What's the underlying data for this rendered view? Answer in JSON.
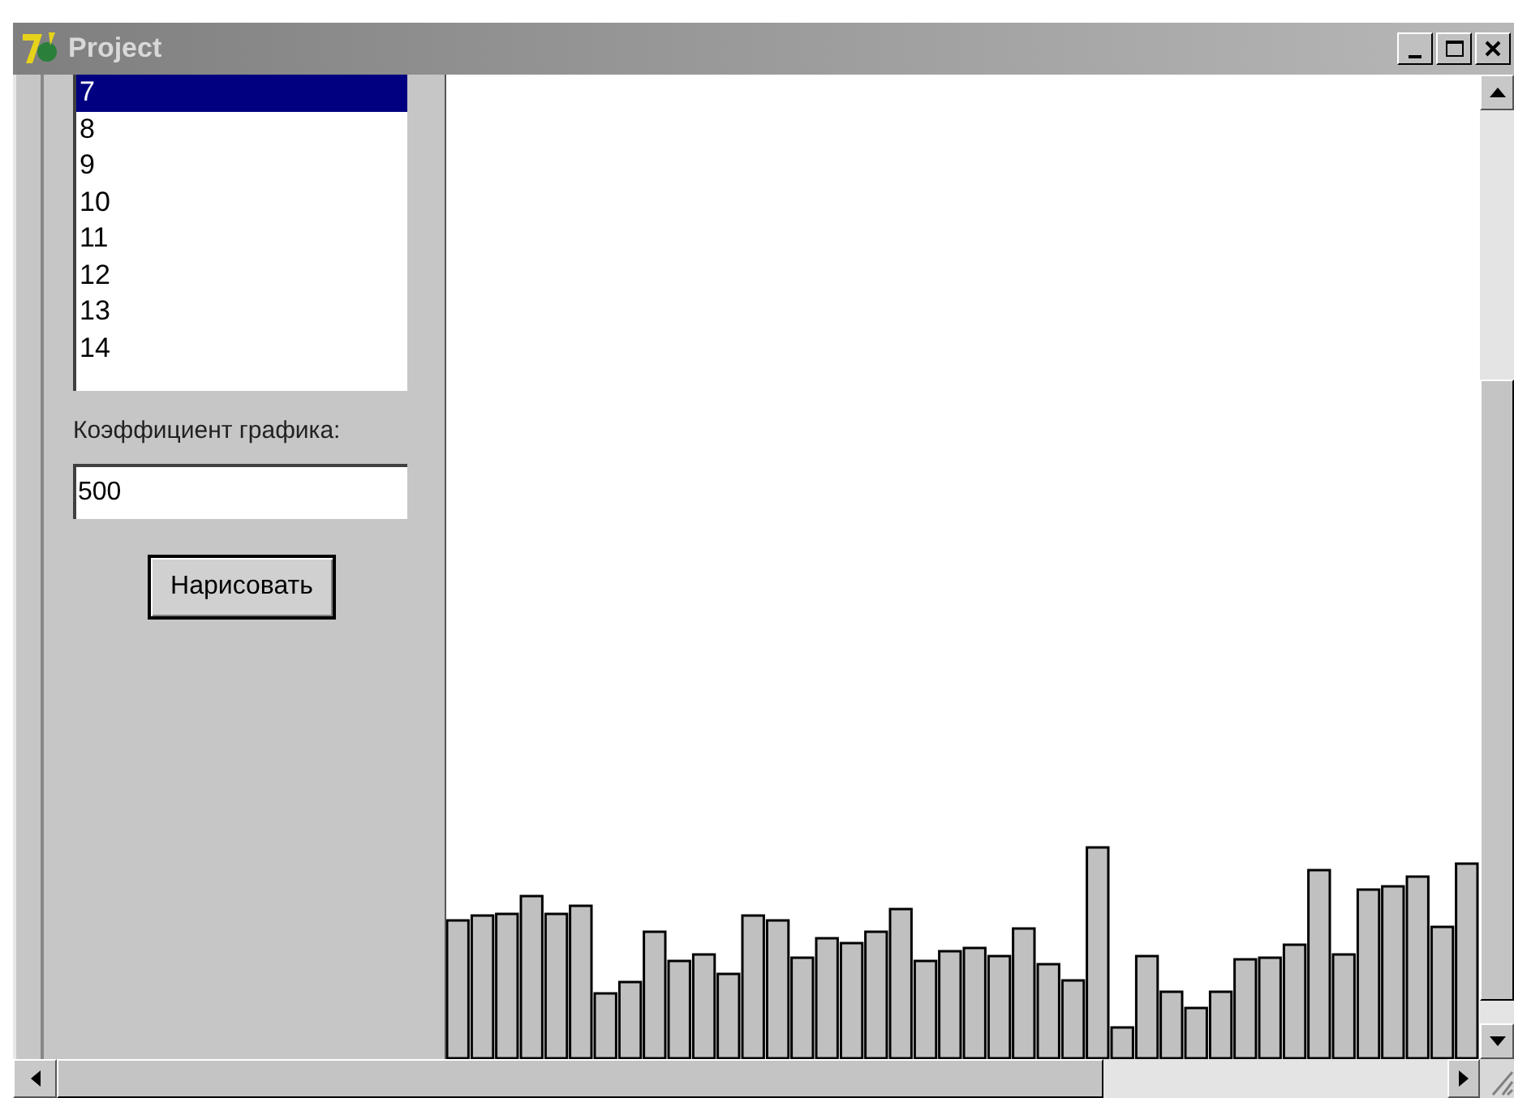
{
  "window": {
    "title": "Project"
  },
  "list": {
    "items": [
      {
        "label": "7",
        "selected": true
      },
      {
        "label": "8",
        "selected": false
      },
      {
        "label": "9",
        "selected": false
      },
      {
        "label": "10",
        "selected": false
      },
      {
        "label": "11",
        "selected": false
      },
      {
        "label": "12",
        "selected": false
      },
      {
        "label": "13",
        "selected": false
      },
      {
        "label": "14",
        "selected": false
      }
    ]
  },
  "coefficient": {
    "label": "Коэффициент графика:",
    "value": "500"
  },
  "draw_button": {
    "label": "Нарисовать"
  }
}
